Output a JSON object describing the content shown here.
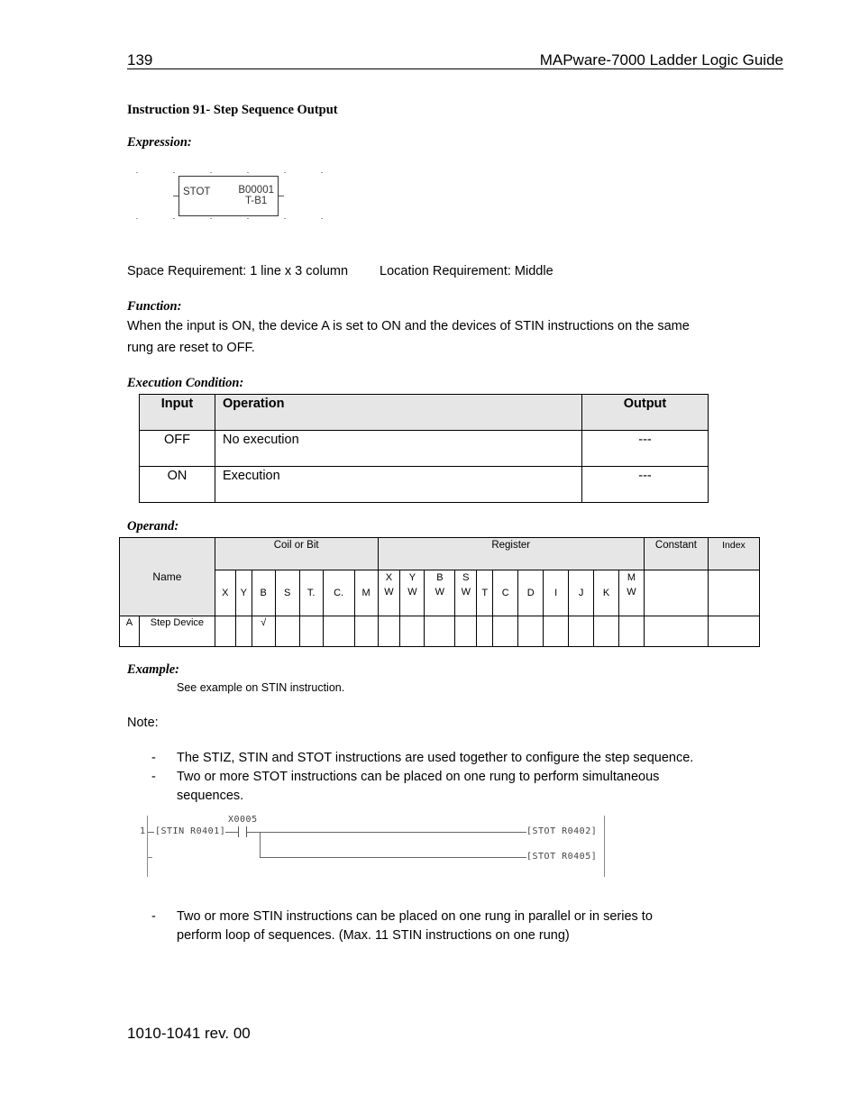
{
  "header": {
    "page_number": "139",
    "guide_title": "MAPware-7000 Ladder Logic Guide"
  },
  "instruction_title": "Instruction 91- Step Sequence Output",
  "expression": {
    "label": "Expression:",
    "block": {
      "mnemonic": "STOT",
      "device": "B00001",
      "sub_device": "T-B1"
    }
  },
  "requirements": {
    "space": "Space Requirement: 1 line x 3 column",
    "location": "Location Requirement: Middle"
  },
  "function": {
    "label": "Function:",
    "text_line1": "When the input is ON, the device A is set to ON and the devices of STIN instructions on the same",
    "text_line2": "rung are reset to OFF."
  },
  "execution_condition": {
    "label": "Execution Condition:",
    "headers": [
      "Input",
      "Operation",
      "Output"
    ],
    "rows": [
      [
        "OFF",
        "No execution",
        "---"
      ],
      [
        "ON",
        "Execution",
        "---"
      ]
    ]
  },
  "operand": {
    "label": "Operand:",
    "group_headers": {
      "coil": "Coil or Bit",
      "register": "Register",
      "constant": "Constant",
      "index": "Index"
    },
    "name_header": "Name",
    "coil_columns": [
      "X",
      "Y",
      "B",
      "S",
      "T.",
      "C.",
      "M"
    ],
    "register_columns": [
      [
        "X",
        "W"
      ],
      [
        "Y",
        "W"
      ],
      [
        "B",
        "W"
      ],
      [
        "S",
        "W"
      ],
      [
        "T",
        ""
      ],
      [
        "C",
        ""
      ],
      [
        "D",
        ""
      ],
      [
        "I",
        ""
      ],
      [
        "J",
        ""
      ],
      [
        "K",
        ""
      ],
      [
        "M",
        "W"
      ]
    ],
    "rows": [
      {
        "id": "A",
        "name": "Step Device",
        "coil": [
          "",
          "",
          "√",
          "",
          "",
          "",
          ""
        ],
        "register": [
          "",
          "",
          "",
          "",
          "",
          "",
          "",
          "",
          "",
          "",
          ""
        ],
        "constant": "",
        "index": ""
      }
    ]
  },
  "example": {
    "label": "Example:",
    "text": "See example on STIN instruction."
  },
  "note": {
    "label": "Note:",
    "dash": "-",
    "items": [
      "The STIZ, STIN and STOT instructions are used together to configure the step sequence.",
      "Two or more STOT instructions can be placed on one rung to perform simultaneous",
      "sequences.",
      "Two or more STIN instructions can be placed on one rung in parallel or in series to",
      "perform loop of sequences. (Max. 11 STIN instructions on one rung)"
    ]
  },
  "ladder": {
    "rung_number": "1",
    "input_instruction": "[STIN R0401]",
    "contact": "X0005",
    "output1": "[STOT R0402]",
    "output2": "[STOT R0405]"
  },
  "footer": {
    "doc_number": "1010-1041 rev. 00"
  }
}
